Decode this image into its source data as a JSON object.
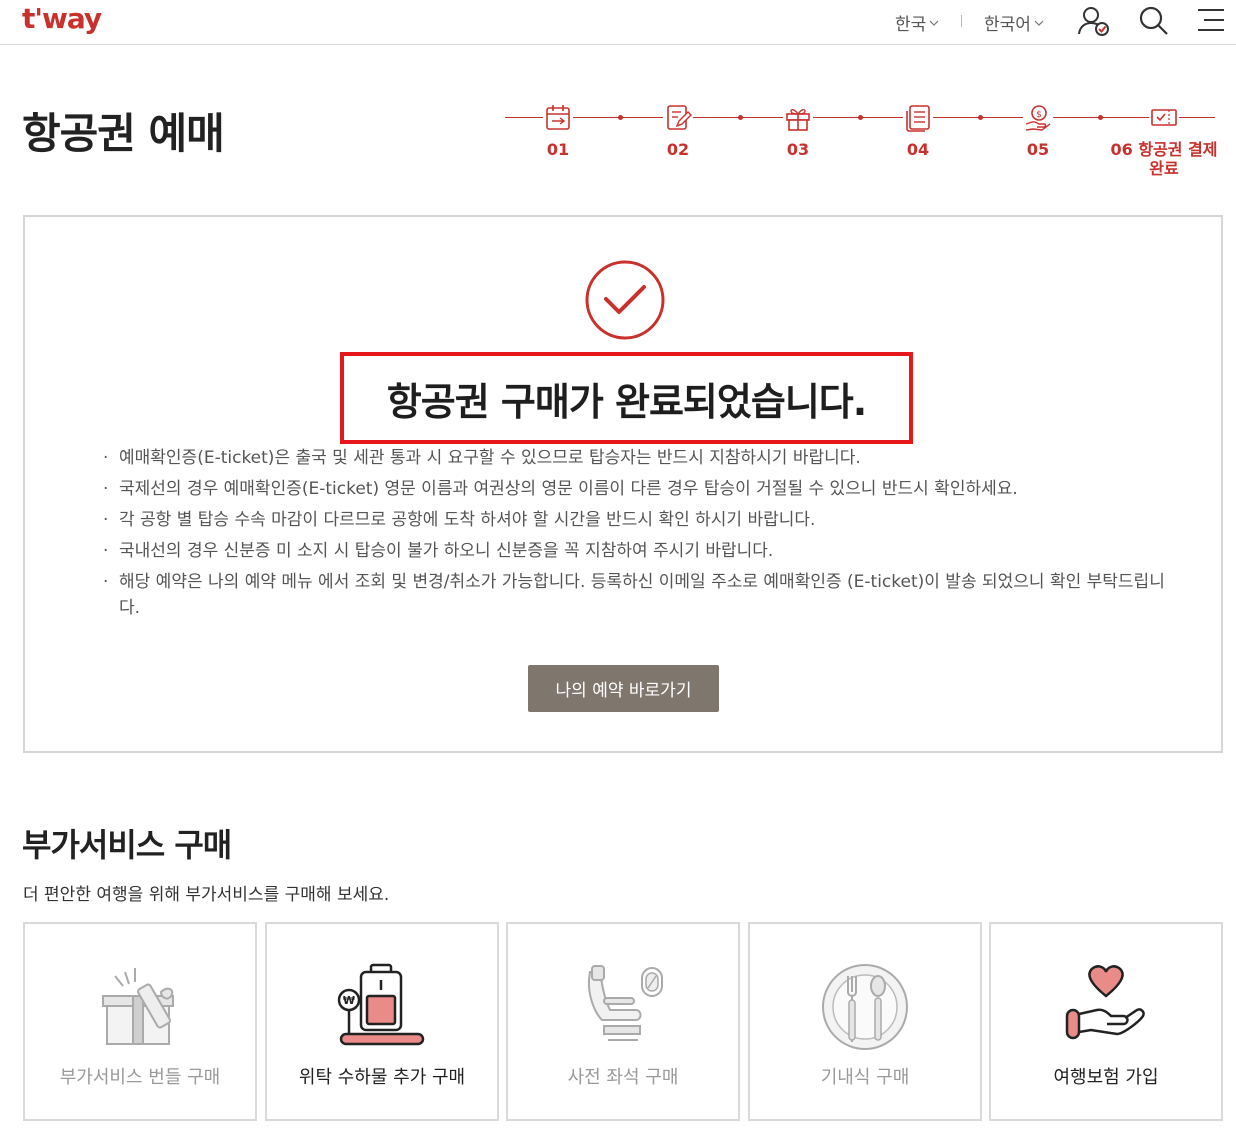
{
  "header": {
    "logo": "t'way",
    "country": "한국",
    "language": "한국어",
    "icons": [
      "user-check-icon",
      "search-icon",
      "menu-icon"
    ]
  },
  "page": {
    "title": "항공권 예매"
  },
  "steps": [
    {
      "num": "01",
      "icon": "calendar-plane-icon",
      "active": false
    },
    {
      "num": "02",
      "icon": "edit-document-icon",
      "active": false
    },
    {
      "num": "03",
      "icon": "gift-icon",
      "active": false
    },
    {
      "num": "04",
      "icon": "list-document-icon",
      "active": false
    },
    {
      "num": "05",
      "icon": "payment-hand-icon",
      "active": false
    },
    {
      "num": "06 항공권 결제 완료",
      "icon": "ticket-check-icon",
      "active": true
    }
  ],
  "completion": {
    "title": "항공권 구매가 완료되었습니다.",
    "notices": [
      "예매확인증(E-ticket)은 출국 및 세관 통과 시 요구할 수 있으므로 탑승자는 반드시 지참하시기 바랍니다.",
      "국제선의 경우 예매확인증(E-ticket) 영문 이름과 여권상의 영문 이름이 다른 경우 탑승이 거절될 수 있으니 반드시 확인하세요.",
      "각 공항 별 탑승 수속 마감이 다르므로 공항에 도착 하셔야 할 시간을 반드시 확인 하시기 바랍니다.",
      "국내선의 경우 신분증 미 소지 시 탑승이 불가 하오니 신분증을 꼭 지참하여 주시기 바랍니다.",
      "해당 예약은 나의 예약 메뉴 에서 조회 및 변경/취소가 가능합니다. 등록하신 이메일 주소로 예매확인증 (E-ticket)이 발송 되었으니 확인 부탁드립니다."
    ],
    "button": "나의 예약 바로가기"
  },
  "extras": {
    "title": "부가서비스 구매",
    "subtitle": "더 편안한 여행을 위해 부가서비스를 구매해 보세요.",
    "cards": [
      {
        "label": "부가서비스 번들 구매",
        "icon": "bundle-gift-icon",
        "enabled": false
      },
      {
        "label": "위탁 수하물 추가 구매",
        "icon": "baggage-scale-icon",
        "enabled": true
      },
      {
        "label": "사전 좌석 구매",
        "icon": "airplane-seat-icon",
        "enabled": false
      },
      {
        "label": "기내식 구매",
        "icon": "meal-plate-icon",
        "enabled": false
      },
      {
        "label": "여행보험 가입",
        "icon": "heart-hand-icon",
        "enabled": true
      }
    ]
  },
  "colors": {
    "brand": "#c8312c",
    "button": "#7f766e",
    "highlight_frame": "#e5171b"
  }
}
